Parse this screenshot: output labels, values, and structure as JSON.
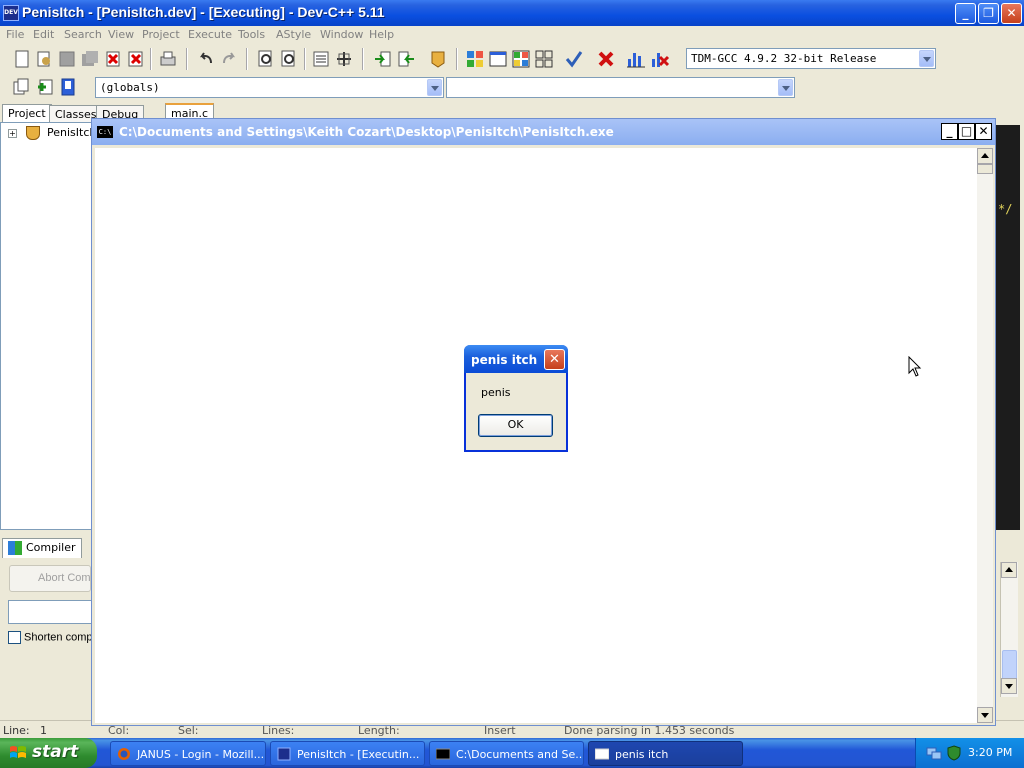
{
  "app": {
    "title": "PenisItch - [PenisItch.dev] - [Executing] - Dev-C++ 5.11",
    "icon_label": "DEV",
    "menu": [
      "File",
      "Edit",
      "Search",
      "View",
      "Project",
      "Execute",
      "Tools",
      "AStyle",
      "Window",
      "Help"
    ],
    "compiler_select": "TDM-GCC 4.9.2 32-bit Release",
    "scope_select": "(globals)",
    "function_select": "",
    "tabs": [
      "Project",
      "Classes",
      "Debug"
    ],
    "editor_tab": "main.c",
    "project_tree_item": "PenisItch",
    "editor_visible_text": "*/",
    "compiler_tab": "Compiler",
    "abort_button": "Abort Com",
    "shorten_checkbox": "Shorten comp",
    "status": {
      "line_label": "Line:",
      "line_value": "1",
      "col": "Col:",
      "sel": "Sel:",
      "lines": "Lines:",
      "length": "Length:",
      "mode": "Insert",
      "message": "Done parsing in 1.453 seconds"
    }
  },
  "console": {
    "icon_label": "C:\\",
    "title": "C:\\Documents and Settings\\Keith Cozart\\Desktop\\PenisItch\\PenisItch.exe"
  },
  "dialog": {
    "title": "penis itch",
    "message": "penis",
    "ok_label": "OK"
  },
  "taskbar": {
    "start_label": "start",
    "items": [
      {
        "label": "JANUS - Login - Mozill..."
      },
      {
        "label": "PenisItch - [Executin..."
      },
      {
        "label": "C:\\Documents and Se..."
      },
      {
        "label": "penis itch"
      }
    ],
    "clock": "3:20 PM"
  },
  "colors": {
    "xp_blue": "#0A4FE0",
    "close_red": "#C5401B",
    "taskbar_blue": "#2355D2",
    "start_green": "#2E8B2E"
  }
}
